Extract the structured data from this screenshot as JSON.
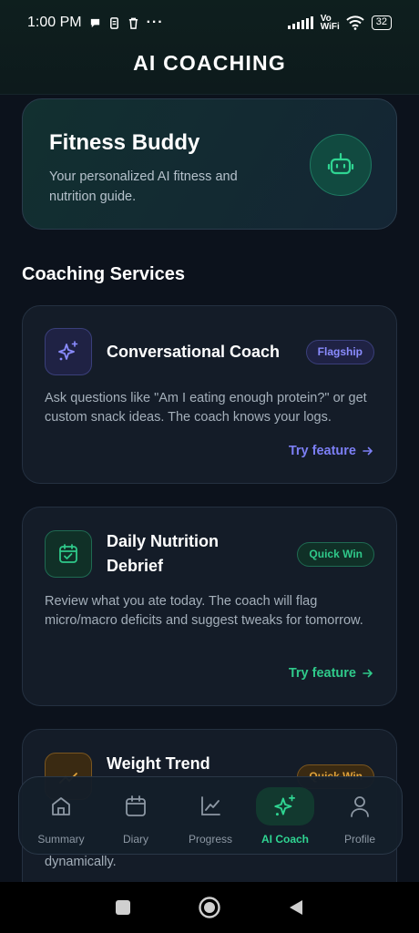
{
  "status_bar": {
    "time": "1:00 PM",
    "more": "···",
    "network": "Vo WiFi",
    "battery": "32"
  },
  "header": {
    "title": "AI COACHING"
  },
  "hero": {
    "title": "Fitness Buddy",
    "subtitle": "Your personalized AI fitness and nutrition guide.",
    "icon": "robot-icon"
  },
  "section_title": "Coaching Services",
  "services": [
    {
      "title": "Conversational Coach",
      "badge": "Flagship",
      "description": "Ask questions like \"Am I eating enough protein?\" or get custom snack ideas. The coach knows your logs.",
      "cta": "Try feature",
      "icon": "sparkles-icon",
      "accent": "#7c7ff5"
    },
    {
      "title": "Daily Nutrition Debrief",
      "badge": "Quick Win",
      "description": "Review what you ate today. The coach will flag micro/macro deficits and suggest tweaks for tomorrow.",
      "cta": "Try feature",
      "icon": "calendar-check-icon",
      "accent": "#2fc98a"
    },
    {
      "title": "Weight Trend",
      "badge": "Quick Win",
      "description_tail": "dynamically.",
      "icon": "trend-icon",
      "accent": "#e0a23a"
    }
  ],
  "nav": [
    {
      "label": "Summary",
      "icon": "home-icon",
      "active": false
    },
    {
      "label": "Diary",
      "icon": "calendar-icon",
      "active": false
    },
    {
      "label": "Progress",
      "icon": "chart-icon",
      "active": false
    },
    {
      "label": "AI Coach",
      "icon": "sparkles-icon",
      "active": true
    },
    {
      "label": "Profile",
      "icon": "user-icon",
      "active": false
    }
  ],
  "colors": {
    "background": "#0c121c",
    "card": "#141c28",
    "primary_green": "#2fd592",
    "indigo": "#7c7ff5",
    "amber": "#e0a23a"
  }
}
